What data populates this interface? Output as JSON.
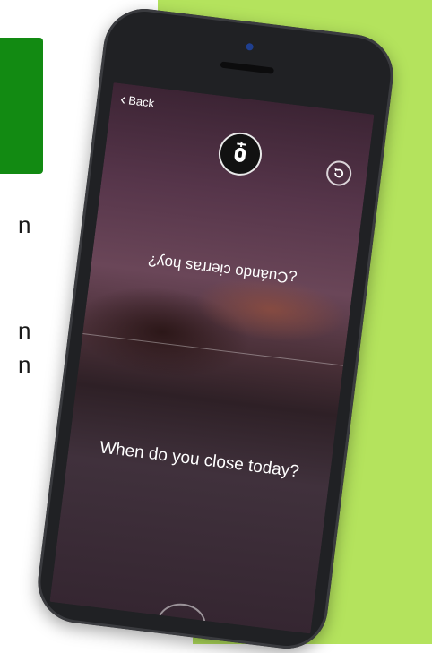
{
  "side_text": {
    "line1": "n",
    "line2": "n",
    "line3": "n"
  },
  "app": {
    "back_label": "Back",
    "source_phrase": "¿Cuándo cierras hoy?",
    "translated_phrase": "When do you close today?"
  },
  "icons": {
    "back": "chevron-left-icon",
    "mic": "microphone-icon",
    "reset": "refresh-icon"
  },
  "colors": {
    "lime": "#b4e35d",
    "green": "#128a12",
    "phone": "#202124"
  }
}
